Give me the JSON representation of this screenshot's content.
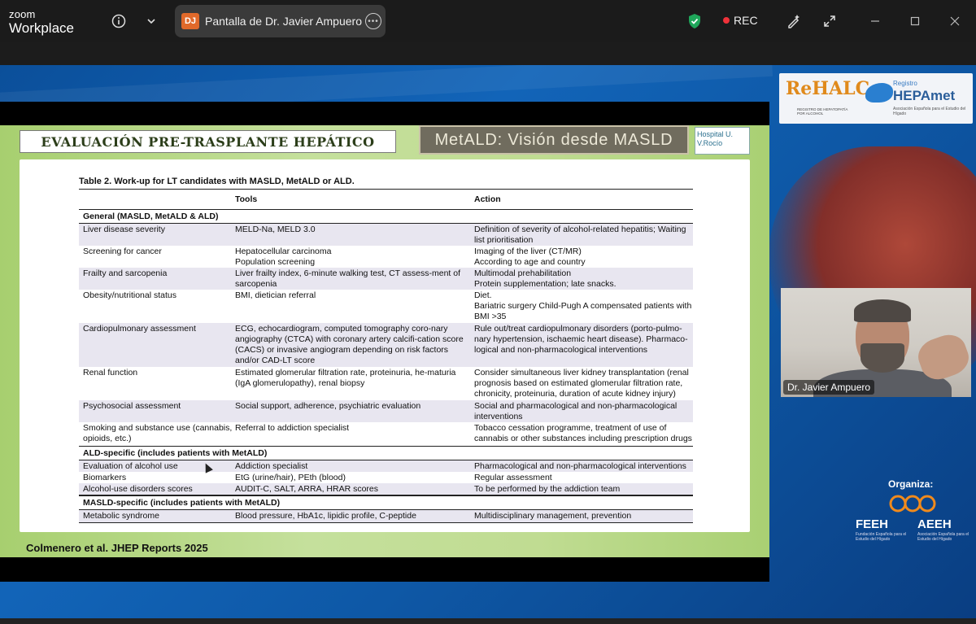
{
  "app": {
    "brand_small": "zoom",
    "brand_big": "Workplace"
  },
  "share": {
    "initials": "DJ",
    "title": "Pantalla de Dr. Javier Ampuero"
  },
  "recording": {
    "label": "REC"
  },
  "colors": {
    "rec": "#f0323a",
    "shield": "#1fa65a",
    "slide_green": "#b6d889"
  },
  "sponsors": {
    "rehalc": "ReHALC",
    "rehalc_sub": "REGISTRO DE HEPATOPATÍA POR ALCOHOL",
    "registro": "Registro",
    "hepamet": "HEPAmet",
    "hepamet_sub": "Asociación Española para el Estudio del Hígado",
    "organiza": "Organiza:",
    "feeh": "FEEH",
    "feeh_sub": "Fundación Española para el Estudio del Hígado",
    "aeeh": "AEEH",
    "aeeh_sub": "Asociación Española para el Estudio del Hígado"
  },
  "video": {
    "name": "Dr. Javier Ampuero"
  },
  "slide": {
    "title": "EVALUACIÓN PRE-TRASPLANTE HEPÁTICO",
    "subtitle": "MetALD: Visión desde MASLD",
    "hospital": "Hospital U. V.Rocío",
    "caption": "Table 2. Work-up for LT candidates with MASLD, MetALD or ALD.",
    "col_tools": "Tools",
    "col_action": "Action",
    "section_general": "General (MASLD, MetALD & ALD)",
    "section_ald": "ALD-specific (includes patients with MetALD)",
    "section_masld": "MASLD-specific (includes patients with MetALD)",
    "rows_general": [
      {
        "c1": "Liver disease severity",
        "c2": "MELD-Na, MELD 3.0",
        "c3": "Definition of severity of alcohol-related hepatitis; Waiting list prioritisation"
      },
      {
        "c1": "Screening for cancer",
        "c2": "Hepatocellular carcinoma\nPopulation screening",
        "c3": "Imaging of the liver (CT/MR)\nAccording to age and country"
      },
      {
        "c1": "Frailty and sarcopenia",
        "c2": "Liver frailty index, 6-minute walking test, CT assess-ment of sarcopenia",
        "c3": "Multimodal prehabilitation\nProtein supplementation; late snacks."
      },
      {
        "c1": "Obesity/nutritional status",
        "c2": "BMI, dietician referral",
        "c3": "Diet.\nBariatric surgery Child-Pugh A compensated patients with BMI >35"
      },
      {
        "c1": "Cardiopulmonary assessment",
        "c2": "ECG, echocardiogram, computed tomography coro-nary angiography (CTCA) with coronary artery calcifi-cation score (CACS) or invasive angiogram depending on risk factors and/or CAD-LT score",
        "c3": "Rule out/treat cardiopulmonary disorders (porto-pulmo-nary hypertension, ischaemic heart disease). Pharmaco-logical and non-pharmacological interventions"
      },
      {
        "c1": "Renal function",
        "c2": "Estimated glomerular filtration rate, proteinuria, he-maturia (IgA glomerulopathy), renal biopsy",
        "c3": "Consider simultaneous liver kidney transplantation (renal prognosis based on estimated glomerular filtration rate, chronicity, proteinuria, duration of acute kidney injury)"
      },
      {
        "c1": "Psychosocial assessment",
        "c2": "Social support, adherence, psychiatric evaluation",
        "c3": "Social and pharmacological and non-pharmacological interventions"
      },
      {
        "c1": "Smoking and substance use (cannabis, opioids, etc.)",
        "c2": "Referral to addiction specialist",
        "c3": "Tobacco cessation programme, treatment of use of cannabis or other substances including prescription drugs"
      }
    ],
    "rows_ald": [
      {
        "c1": "Evaluation of alcohol use",
        "c2": "Addiction specialist",
        "c3": "Pharmacological and non-pharmacological interventions"
      },
      {
        "c1": "Biomarkers",
        "c2": "EtG (urine/hair), PEth (blood)",
        "c3": "Regular assessment"
      },
      {
        "c1": "Alcohol-use disorders scores",
        "c2": "AUDIT-C, SALT, ARRA, HRAR scores",
        "c3": "To be performed by the addiction team"
      }
    ],
    "rows_masld": [
      {
        "c1": "Metabolic syndrome",
        "c2": "Blood pressure, HbA1c, lipidic profile, C-peptide",
        "c3": "Multidisciplinary management, prevention"
      }
    ],
    "citation": "Colmenero et al. JHEP Reports 2025"
  }
}
